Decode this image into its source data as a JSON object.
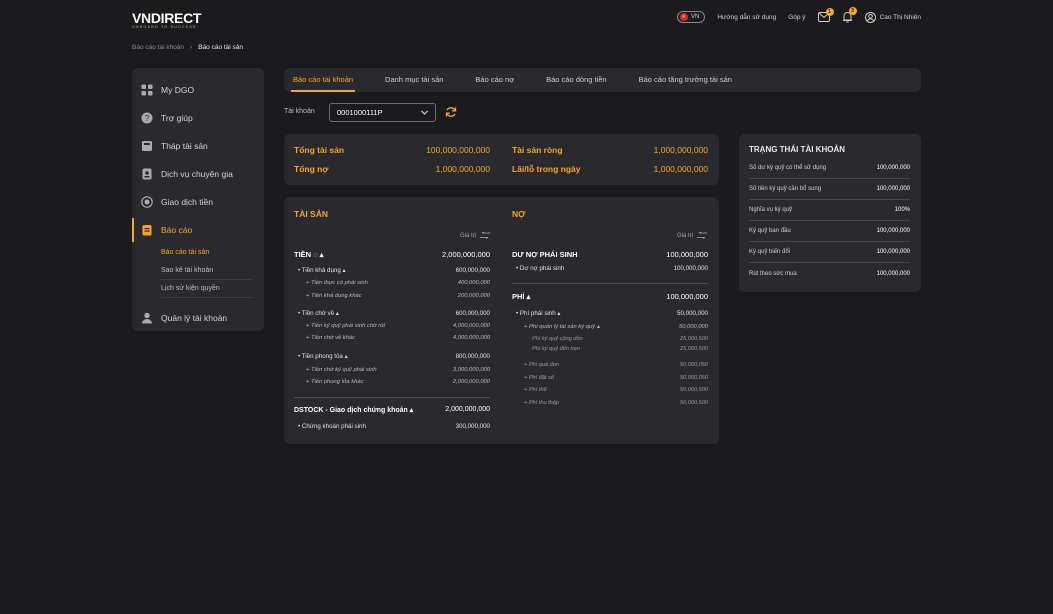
{
  "header": {
    "logo": "VNDIRECT",
    "tagline": "ONBOARD TO SUCCESS",
    "lang": "VN",
    "guide": "Hướng dẫn sử dụng",
    "feedback": "Góp ý",
    "mail_count": "1",
    "bell_count": "3",
    "user_name": "Cao Thị Nhiên"
  },
  "breadcrumb": {
    "parent": "Báo cáo tài khoản",
    "current": "Báo cáo tài sản"
  },
  "sidebar": {
    "items": [
      {
        "label": "My DGO",
        "icon": "grid-icon"
      },
      {
        "label": "Trợ giúp",
        "icon": "help-icon"
      },
      {
        "label": "Tháp tài sản",
        "icon": "pyramid-icon"
      },
      {
        "label": "Dịch vụ chuyên gia",
        "icon": "expert-icon"
      },
      {
        "label": "Giao dịch tiền",
        "icon": "money-icon"
      },
      {
        "label": "Báo cáo",
        "icon": "report-icon"
      },
      {
        "label": "Quản lý tài khoản",
        "icon": "user-icon"
      }
    ],
    "sub_items": [
      "Báo cáo tài sản",
      "Sao kê tài khoản",
      "Lịch sử kiện quyền"
    ]
  },
  "tabs": [
    "Báo cáo tài khoản",
    "Danh mục tài sản",
    "Báo cáo nợ",
    "Báo cáo dòng tiền",
    "Báo cáo tăng trưởng tài sản"
  ],
  "account": {
    "label": "Tài khoản",
    "value": "0001000111P"
  },
  "summary": {
    "total_assets_label": "Tổng tài sản",
    "total_assets": "100,000,000,000",
    "total_debt_label": "Tổng nợ",
    "total_debt": "1,000,000,000",
    "net_assets_label": "Tài sản ròng",
    "net_assets": "1,000,000,000",
    "pnl_label": "Lãi/lỗ trong ngày",
    "pnl": "1,000,000,000"
  },
  "assets": {
    "title": "TÀI SẢN",
    "value_header": "Giá trị",
    "cash_label": "TIỀN",
    "cash": "2,000,000,000",
    "avail_label": "Tiền khả dụng",
    "avail": "600,000,000",
    "actual_label": "Tiền thực có phái sinh",
    "actual": "400,000,000",
    "other_avail_label": "Tiền khả dụng khác",
    "other_avail": "200,000,000",
    "pending_label": "Tiền chờ về",
    "pending": "600,000,000",
    "margin_wait_label": "Tiền ký quỹ phái sinh chờ rút",
    "margin_wait": "4,000,000,000",
    "pending_other_label": "Tiền chờ về khác",
    "pending_other": "4,000,000,000",
    "blocked_label": "Tiền phong tỏa",
    "blocked": "800,000,000",
    "deriv_margin_label": "Tiền chờ ký quỹ phái sinh",
    "deriv_margin": "3,000,000,000",
    "blocked_other_label": "Tiền phong tỏa khác",
    "blocked_other": "2,000,000,000",
    "dstock_label": "DSTOCK - Giao dịch chứng khoán",
    "dstock": "2,000,000,000",
    "deriv_sec_label": "Chứng khoán phái sinh",
    "deriv_sec": "300,000,000"
  },
  "debt": {
    "title": "NỢ",
    "value_header": "Giá trị",
    "deriv_debt_label": "DƯ NỢ PHÁI SINH",
    "deriv_debt": "100,000,000",
    "deriv_debt_sub_label": "Dư nợ phái sinh",
    "deriv_debt_sub": "100,000,000",
    "fee_label": "PHÍ",
    "fee": "100,000,000",
    "deriv_fee_label": "Phí phái sinh",
    "deriv_fee": "50,000,000",
    "mgmt_fee_label": "Phí quản lý tài sản ký quỹ",
    "mgmt_fee": "50,000,000",
    "mgmt_a_label": "Phí ký quỹ cộng dồn",
    "mgmt_a": "25,000,500",
    "mgmt_b_label": "Phí ký quỹ đến hạn",
    "mgmt_b": "25,000,500",
    "f1_label": "Phí quá đơn",
    "f1": "50,000,050",
    "f2_label": "Phí đặt số",
    "f2": "50,000,050",
    "f3_label": "Phí thế",
    "f3": "50,000,500",
    "f4_label": "Phí thu thập",
    "f4": "50,000,500"
  },
  "status": {
    "title": "TRẠNG THÁI TÀI KHOẢN",
    "rows": [
      {
        "label": "Số dư ký quỹ có thể sử dụng",
        "value": "100,000,000"
      },
      {
        "label": "Số tiền ký quỹ cần bổ sung",
        "value": "100,000,000"
      },
      {
        "label": "Nghĩa vụ ký quỹ",
        "value": "100%"
      },
      {
        "label": "Ký quỹ ban đầu",
        "value": "100,000,000"
      },
      {
        "label": "Ký quỹ biến đổi",
        "value": "100,000,000"
      },
      {
        "label": "Rút theo sức mua",
        "value": "100,000,000"
      }
    ]
  }
}
